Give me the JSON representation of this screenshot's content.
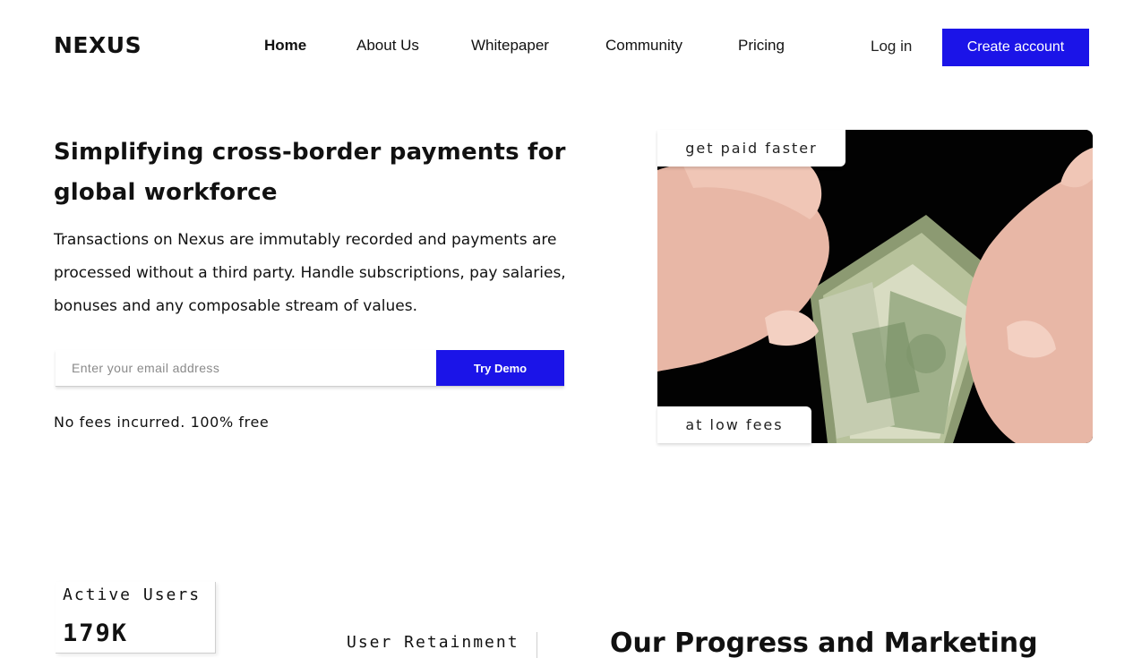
{
  "header": {
    "logo": "NEXUS",
    "nav": [
      {
        "label": "Home",
        "active": true
      },
      {
        "label": "About Us",
        "active": false
      },
      {
        "label": "Whitepaper",
        "active": false
      },
      {
        "label": "Community",
        "active": false
      },
      {
        "label": "Pricing",
        "active": false
      }
    ],
    "login_label": "Log in",
    "create_account_label": "Create account"
  },
  "hero": {
    "title": "Simplifying cross-border payments for global workforce",
    "description": "Transactions on Nexus are immutably recorded and payments are processed without a third party. Handle subscriptions, pay salaries, bonuses and any composable stream of values.",
    "email_placeholder": "Enter your email address",
    "demo_button_label": "Try Demo",
    "fees_note": "No fees incurred. 100% free",
    "image_tags": {
      "top": "get paid faster",
      "bottom": "at low fees"
    }
  },
  "stats": {
    "active_users_label": "Active Users",
    "active_users_value": "179K",
    "retention_label": "User Retainment"
  },
  "progress_section": {
    "title": "Our Progress and Marketing"
  },
  "colors": {
    "accent": "#1b14e8",
    "text": "#111111",
    "background": "#ffffff"
  }
}
